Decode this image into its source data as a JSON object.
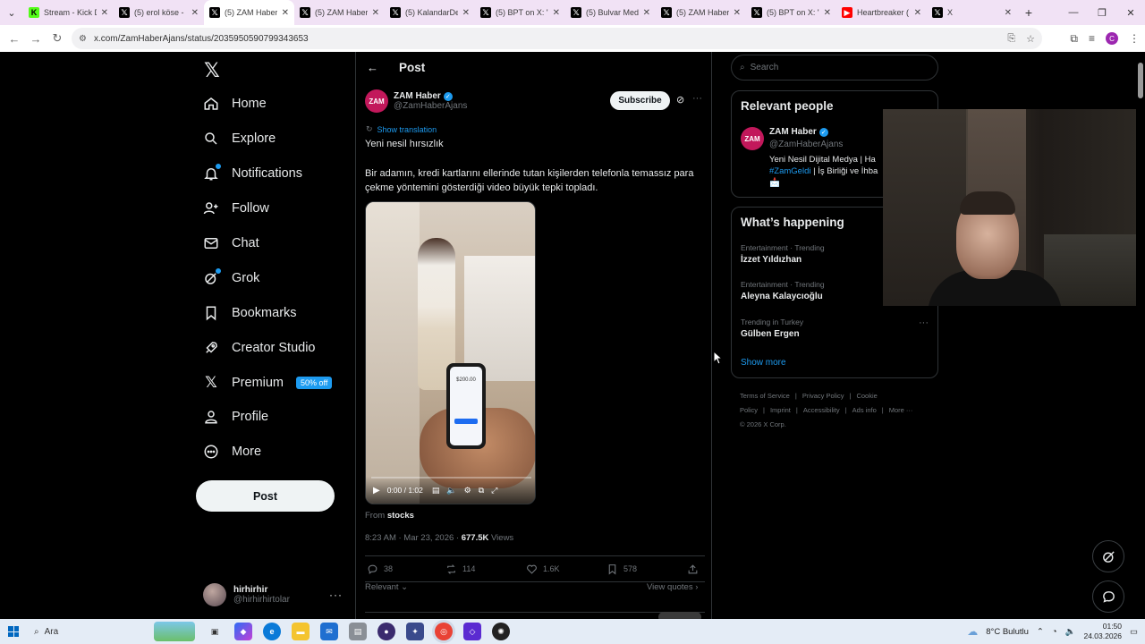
{
  "browser": {
    "tabs": [
      {
        "title": "Stream - Kick D",
        "favicon": "kick-icon",
        "active": false
      },
      {
        "title": "(5) erol köse - ",
        "favicon": "x-icon",
        "active": false
      },
      {
        "title": "(5) ZAM Haber",
        "favicon": "x-icon",
        "active": true
      },
      {
        "title": "(5) ZAM Haber",
        "favicon": "x-icon",
        "active": false
      },
      {
        "title": "(5) KalandarDe",
        "favicon": "x-icon",
        "active": false
      },
      {
        "title": "(5) BPT on X: \"",
        "favicon": "x-icon",
        "active": false
      },
      {
        "title": "(5) Bulvar Med",
        "favicon": "x-icon",
        "active": false
      },
      {
        "title": "(5) ZAM Haber",
        "favicon": "x-icon",
        "active": false
      },
      {
        "title": "(5) BPT on X: \"",
        "favicon": "x-icon",
        "active": false
      },
      {
        "title": "Heartbreaker (",
        "favicon": "youtube-icon",
        "active": false
      },
      {
        "title": "X",
        "favicon": "x-icon",
        "active": false
      }
    ],
    "url": "x.com/ZamHaberAjans/status/2035950590799343653",
    "profile_initial": "C"
  },
  "nav": {
    "items": [
      {
        "label": "Home",
        "icon": "home-icon"
      },
      {
        "label": "Explore",
        "icon": "search-icon"
      },
      {
        "label": "Notifications",
        "icon": "bell-icon"
      },
      {
        "label": "Follow",
        "icon": "add-person-icon"
      },
      {
        "label": "Chat",
        "icon": "mail-icon"
      },
      {
        "label": "Grok",
        "icon": "grok-icon"
      },
      {
        "label": "Bookmarks",
        "icon": "bookmark-icon"
      },
      {
        "label": "Creator Studio",
        "icon": "rocket-icon"
      },
      {
        "label": "Premium",
        "icon": "x-icon"
      },
      {
        "label": "Profile",
        "icon": "person-icon"
      },
      {
        "label": "More",
        "icon": "more-circle-icon"
      }
    ],
    "notifications_badge": "5",
    "premium_badge": "50% off",
    "post_button": "Post",
    "account": {
      "name": "hirhirhir",
      "handle": "@hirhirhirtolar"
    }
  },
  "post": {
    "header_title": "Post",
    "author_avatar_text": "ZAM",
    "author_name": "ZAM Haber",
    "author_handle": "@ZamHaberAjans",
    "subscribe_label": "Subscribe",
    "show_translation": "Show translation",
    "text_line1": "Yeni nesil hırsızlık",
    "text_body": "Bir adamın, kredi kartlarını ellerinde tutan kişilerden telefonla temassız para çekme yöntemini gösterdiği video büyük tepki topladı.",
    "video": {
      "time": "0:00 / 1:02",
      "progress_fraction": 0,
      "phone_amount": "$200.00"
    },
    "from_label": "From",
    "from_source": "stocks",
    "timestamp": "8:23 AM · Mar 23, 2026 · ",
    "views_count": "677.5K",
    "views_label": " Views",
    "stats": {
      "replies": "38",
      "reposts": "114",
      "likes": "1.6K",
      "bookmarks": "578"
    },
    "relevant_label": "Relevant",
    "view_quotes": "View quotes"
  },
  "right": {
    "search_placeholder": "Search",
    "relevant_people_title": "Relevant people",
    "person": {
      "name": "ZAM Haber",
      "handle": "@ZamHaberAjans",
      "bio_line1": "Yeni Nesil Dijital Medya | Ha",
      "bio_tag": "#ZamGeldi",
      "bio_line2_rest": " | İş Birliği ve İhba",
      "bio_line3": "📩"
    },
    "happening_title": "What’s happening",
    "trends": [
      {
        "category": "Entertainment · Trending",
        "name": "İzzet Yıldızhan"
      },
      {
        "category": "Entertainment · Trending",
        "name": "Aleyna Kalaycıoğlu"
      },
      {
        "category": "Trending in Turkey",
        "name": "Gülben Ergen"
      }
    ],
    "show_more": "Show more",
    "footer_links": [
      "Terms of Service",
      "|",
      "Privacy Policy",
      "|",
      "Cookie Policy",
      "|",
      "Imprint",
      "|",
      "Accessibility",
      "|",
      "Ads info",
      "|",
      "More ···"
    ],
    "copyright": "© 2026 X Corp."
  },
  "taskbar": {
    "search_label": "Ara",
    "weather": "8°C  Bulutlu",
    "time": "01:50",
    "date": "24.03.2026"
  },
  "colors": {
    "accent": "#1d9bf0",
    "background": "#000000",
    "text": "#e7e9ea",
    "muted": "#71767b"
  }
}
